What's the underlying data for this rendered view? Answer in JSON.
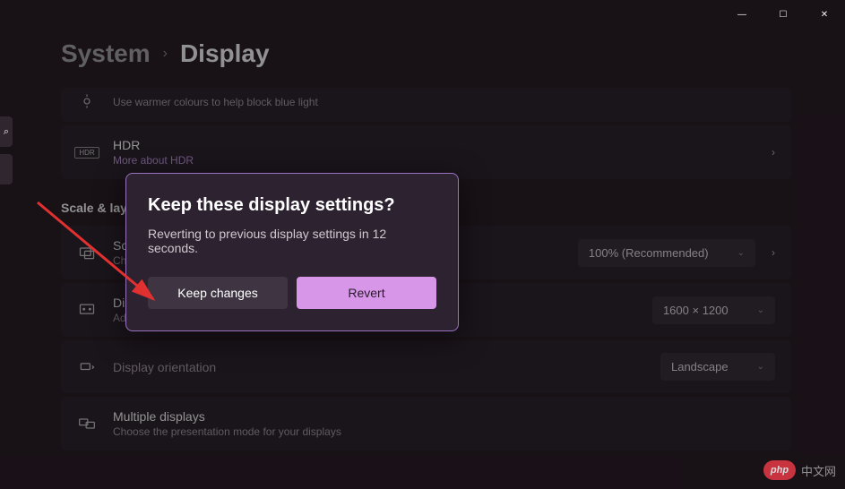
{
  "titlebar": {
    "minimize": "—",
    "maximize": "☐",
    "close": "✕"
  },
  "breadcrumb": {
    "parent": "System",
    "separator": "›",
    "current": "Display"
  },
  "nightlight": {
    "subtitle": "Use warmer colours to help block blue light"
  },
  "hdr": {
    "title": "HDR",
    "link": "More about HDR",
    "badge": "HDR"
  },
  "section": {
    "scale_layout": "Scale & layout"
  },
  "scale": {
    "title": "Scale",
    "subtitle": "Change the size of text, apps, and other items",
    "value": "100% (Recommended)"
  },
  "resolution": {
    "title": "Display resolution",
    "subtitle": "Adjust the resolution to fit your connected display",
    "value": "1600 × 1200"
  },
  "orientation": {
    "title": "Display orientation",
    "value": "Landscape"
  },
  "multiple": {
    "title": "Multiple displays",
    "subtitle": "Choose the presentation mode for your displays"
  },
  "dialog": {
    "title": "Keep these display settings?",
    "body": "Reverting to previous display settings in 12 seconds.",
    "keep": "Keep changes",
    "revert": "Revert"
  },
  "watermark": {
    "logo": "php",
    "text": "中文网"
  },
  "icons": {
    "search": "⌕"
  }
}
